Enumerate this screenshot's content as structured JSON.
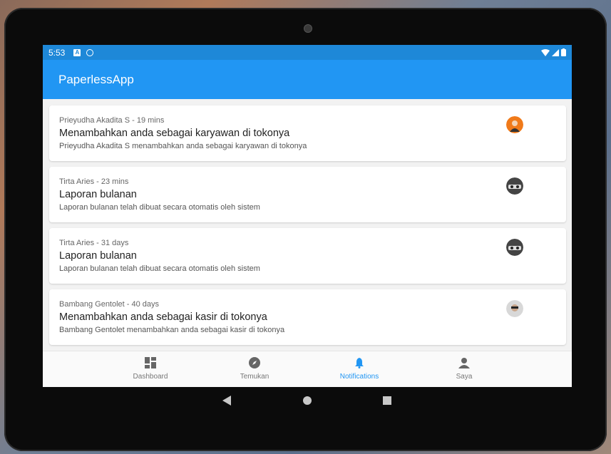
{
  "statusbar": {
    "time": "5:53",
    "icons": [
      "a-icon",
      "at-icon",
      "wifi-icon",
      "signal-icon",
      "battery-icon"
    ]
  },
  "appbar": {
    "title": "PaperlessApp"
  },
  "notifications": [
    {
      "meta": "Prieyudha Akadita S - 19 mins",
      "title": "Menambahkan anda sebagai karyawan di tokonya",
      "desc": "Prieyudha Akadita S menambahkan anda sebagai karyawan di tokonya"
    },
    {
      "meta": "Tirta Aries - 23 mins",
      "title": "Laporan bulanan",
      "desc": "Laporan bulanan telah dibuat secara otomatis oleh sistem"
    },
    {
      "meta": "Tirta Aries - 31 days",
      "title": "Laporan bulanan",
      "desc": "Laporan bulanan telah dibuat secara otomatis oleh sistem"
    },
    {
      "meta": "Bambang Gentolet - 40 days",
      "title": "Menambahkan anda sebagai kasir di tokonya",
      "desc": "Bambang Gentolet menambahkan anda sebagai kasir di tokonya"
    }
  ],
  "bottomnav": {
    "items": [
      {
        "label": "Dashboard",
        "icon": "dashboard-icon"
      },
      {
        "label": "Temukan",
        "icon": "compass-icon"
      },
      {
        "label": "Notifications",
        "icon": "bell-icon"
      },
      {
        "label": "Saya",
        "icon": "person-icon"
      }
    ],
    "active": "Notifications"
  },
  "colors": {
    "primary": "#2196f3",
    "statusbar": "#1e88d8"
  }
}
